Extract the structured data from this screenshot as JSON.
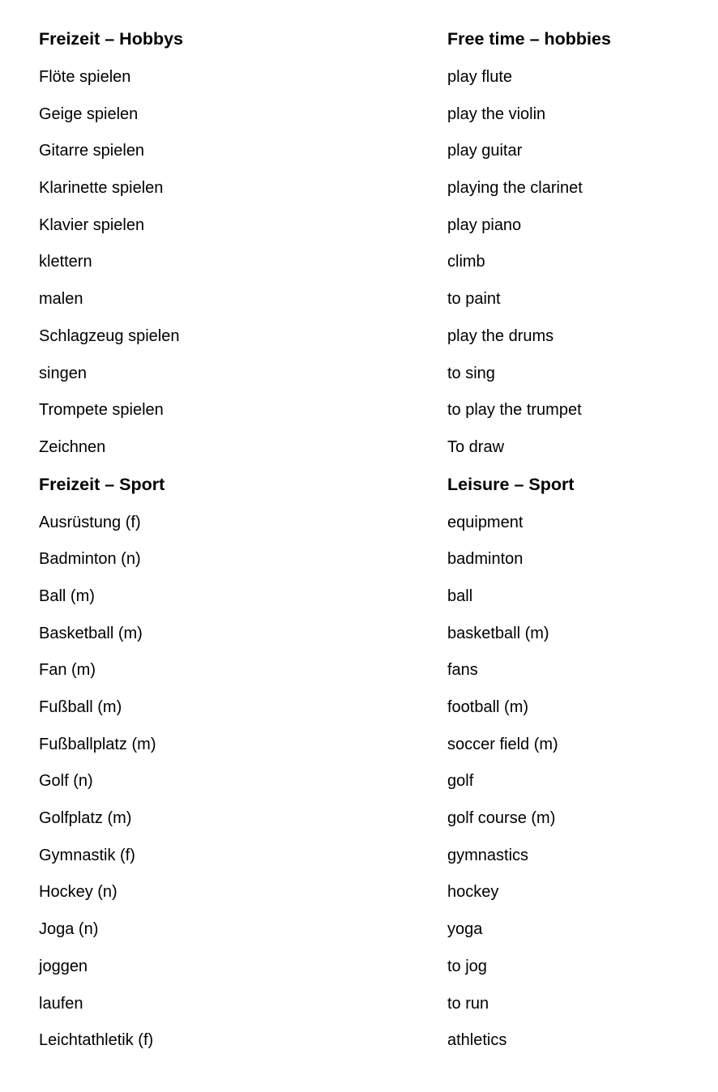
{
  "document": {
    "type": "bilingual-glossary",
    "language_columns": [
      "German",
      "English"
    ],
    "sections": [
      {
        "heading": {
          "source": "Freizeit – Hobbys",
          "target": "Free time – hobbies"
        },
        "entries": [
          {
            "source": "Flöte spielen",
            "target": "play flute"
          },
          {
            "source": "Geige spielen",
            "target": "play the violin"
          },
          {
            "source": "Gitarre spielen",
            "target": "play guitar"
          },
          {
            "source": "Klarinette spielen",
            "target": "playing the clarinet"
          },
          {
            "source": "Klavier spielen",
            "target": "play piano"
          },
          {
            "source": "klettern",
            "target": "climb"
          },
          {
            "source": "malen",
            "target": "to paint"
          },
          {
            "source": "Schlagzeug spielen",
            "target": "play the drums"
          },
          {
            "source": "singen",
            "target": "to sing"
          },
          {
            "source": "Trompete spielen",
            "target": "to play the trumpet"
          },
          {
            "source": "Zeichnen",
            "target": "To draw"
          }
        ]
      },
      {
        "heading": {
          "source": "Freizeit – Sport",
          "target": "Leisure – Sport"
        },
        "entries": [
          {
            "source": "Ausrüstung (f)",
            "target": "equipment"
          },
          {
            "source": "Badminton (n)",
            "target": "badminton"
          },
          {
            "source": "Ball (m)",
            "target": "ball"
          },
          {
            "source": "Basketball (m)",
            "target": "basketball (m)"
          },
          {
            "source": "Fan (m)",
            "target": "fans"
          },
          {
            "source": "Fußball (m)",
            "target": "football (m)"
          },
          {
            "source": "Fußballplatz (m)",
            "target": "soccer field (m)"
          },
          {
            "source": "Golf (n)",
            "target": "golf"
          },
          {
            "source": "Golfplatz (m)",
            "target": "golf course (m)"
          },
          {
            "source": "Gymnastik (f)",
            "target": "gymnastics"
          },
          {
            "source": "Hockey (n)",
            "target": "hockey"
          },
          {
            "source": "Joga (n)",
            "target": "yoga"
          },
          {
            "source": "joggen",
            "target": "to jog"
          },
          {
            "source": "laufen",
            "target": "to run"
          },
          {
            "source": "Leichtathletik (f)",
            "target": "athletics"
          }
        ]
      }
    ]
  }
}
